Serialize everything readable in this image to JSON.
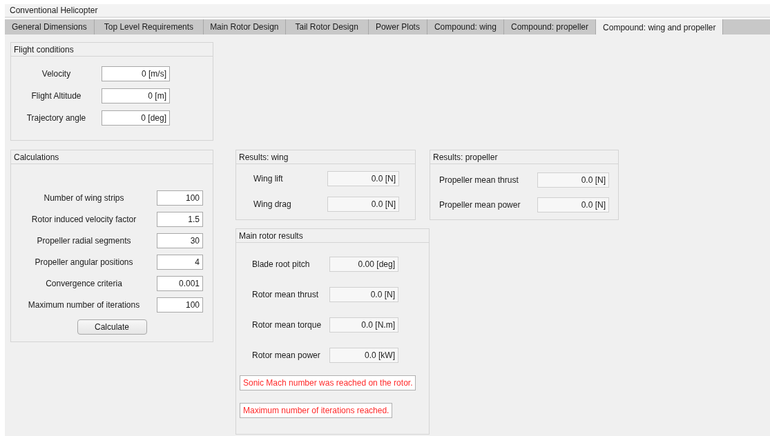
{
  "window": {
    "title": "Conventional Helicopter"
  },
  "tabs": [
    {
      "label": "General Dimensions",
      "selected": false
    },
    {
      "label": "Top Level Requirements",
      "selected": false
    },
    {
      "label": "Main Rotor Design",
      "selected": false
    },
    {
      "label": "Tail Rotor Design",
      "selected": false
    },
    {
      "label": "Power Plots",
      "selected": false
    },
    {
      "label": "Compound: wing",
      "selected": false
    },
    {
      "label": "Compound: propeller",
      "selected": false
    },
    {
      "label": "Compound: wing and propeller",
      "selected": true
    }
  ],
  "flight_conditions": {
    "title": "Flight conditions",
    "fields": [
      {
        "label": "Velocity",
        "value": "0 [m/s]"
      },
      {
        "label": "Flight Altitude",
        "value": "0 [m]"
      },
      {
        "label": "Trajectory angle",
        "value": "0 [deg]"
      }
    ]
  },
  "calculations": {
    "title": "Calculations",
    "fields": [
      {
        "label": "Number of wing strips",
        "value": "100"
      },
      {
        "label": "Rotor induced velocity factor",
        "value": "1.5"
      },
      {
        "label": "Propeller radial segments",
        "value": "30"
      },
      {
        "label": "Propeller angular positions",
        "value": "4"
      },
      {
        "label": "Convergence criteria",
        "value": "0.001"
      },
      {
        "label": "Maximum number of iterations",
        "value": "100"
      }
    ],
    "button": "Calculate"
  },
  "results_wing": {
    "title": "Results: wing",
    "fields": [
      {
        "label": "Wing lift",
        "value": "0.0 [N]"
      },
      {
        "label": "Wing drag",
        "value": "0.0 [N]"
      }
    ]
  },
  "results_propeller": {
    "title": "Results: propeller",
    "fields": [
      {
        "label": "Propeller mean thrust",
        "value": "0.0 [N]"
      },
      {
        "label": "Propeller mean power",
        "value": "0.0 [N]"
      }
    ]
  },
  "main_rotor_results": {
    "title": "Main rotor results",
    "fields": [
      {
        "label": "Blade root pitch",
        "value": "0.00 [deg]"
      },
      {
        "label": "Rotor mean thrust",
        "value": "0.0 [N]"
      },
      {
        "label": "Rotor mean torque",
        "value": "0.0 [N.m]"
      },
      {
        "label": "Rotor mean power",
        "value": "0.0 [kW]"
      }
    ],
    "messages": [
      "Sonic Mach number was reached on the rotor.",
      "Maximum number of iterations reached."
    ]
  }
}
